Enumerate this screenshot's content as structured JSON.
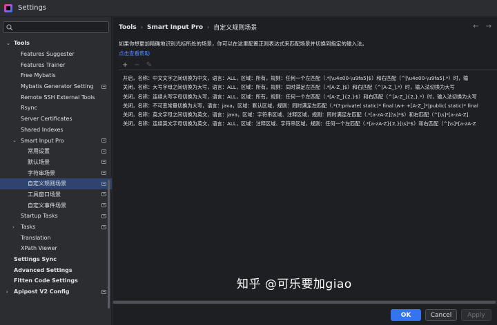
{
  "window": {
    "title": "Settings"
  },
  "search": {
    "value": ""
  },
  "sidebar": {
    "items": [
      {
        "label": "Tools",
        "bold": true,
        "indent": 0,
        "chevron": "down",
        "project": false
      },
      {
        "label": "Features Suggester",
        "indent": 1,
        "project": false
      },
      {
        "label": "Features Trainer",
        "indent": 1,
        "project": false
      },
      {
        "label": "Free Mybatis",
        "indent": 1,
        "project": false
      },
      {
        "label": "Mybatis Generator Setting",
        "indent": 1,
        "project": true
      },
      {
        "label": "Remote SSH External Tools",
        "indent": 1,
        "project": false
      },
      {
        "label": "Rsync",
        "indent": 1,
        "project": false
      },
      {
        "label": "Server Certificates",
        "indent": 1,
        "project": false
      },
      {
        "label": "Shared Indexes",
        "indent": 1,
        "project": false
      },
      {
        "label": "Smart Input Pro",
        "indent": 1,
        "chevron": "down",
        "project": true
      },
      {
        "label": "常用设置",
        "indent": 2,
        "project": true
      },
      {
        "label": "默认场景",
        "indent": 2,
        "project": true
      },
      {
        "label": "字符串场景",
        "indent": 2,
        "project": true
      },
      {
        "label": "自定义规则场景",
        "indent": 2,
        "project": true,
        "selected": true
      },
      {
        "label": "工具窗口场景",
        "indent": 2,
        "project": true
      },
      {
        "label": "自定义事件场景",
        "indent": 2,
        "project": true
      },
      {
        "label": "Startup Tasks",
        "indent": 1,
        "project": true
      },
      {
        "label": "Tasks",
        "indent": 1,
        "chevron": "right",
        "project": true
      },
      {
        "label": "Translation",
        "indent": 1,
        "project": false
      },
      {
        "label": "XPath Viewer",
        "indent": 1,
        "project": false
      },
      {
        "label": "Settings Sync",
        "bold": true,
        "indent": 0,
        "project": false
      },
      {
        "label": "Advanced Settings",
        "bold": true,
        "indent": 0,
        "project": false
      },
      {
        "label": "Fitten Code Settings",
        "bold": true,
        "indent": 0,
        "project": false
      },
      {
        "label": "Apipost V2 Config",
        "bold": true,
        "indent": 0,
        "chevron": "right",
        "project": true
      }
    ]
  },
  "breadcrumb": [
    "Tools",
    "Smart Input Pro",
    "自定义规则场景"
  ],
  "main": {
    "description": "如果你想更加精确地识别光标所处的场景，你可以在这里配置正则表达式来匹配场景并切换到指定的输入法。",
    "help_link": "点击查看帮助",
    "toolbar": {
      "add": "+",
      "remove": "−",
      "edit": "✎"
    },
    "rules": [
      "开启，名称：中文文字之间切换为中文，语言：ALL，区域：所有，规则：任何一个左匹配（.*[\\u4e00-\\u9fa5]$）和右匹配（^[\\u4e00-\\u9fa5].*）时，输",
      "关闭，名称：大写字母之间切换为大写，语言：ALL，区域：所有，规则：同时满足左匹配（.*[A-Z_]$）和右匹配（^[A-Z_].*）时，输入法切换为大写",
      "关闭，名称：连续大写字母切换为大写，语言：ALL，区域：所有，规则：任何一个左匹配（.*[A-Z_]{2,}$）和右匹配（^[A-Z_]{2,}.*）时，输入法切换为大写",
      "关闭，名称：不可变常量切换为大写，语言：java，区域：默认区域，规则：同时满足左匹配（.*(?:private( static)* final \\w+ +[A-Z_]*|public( static)* final",
      "关闭，名称：英文字母之间切换为英文，语言：java，区域：字符串区域、注释区域，规则：同时满足左匹配（.*[a-zA-Z][\\s]*$）和右匹配（^[\\s]*[a-zA-Z].",
      "关闭，名称：连续英文字母切换为英文，语言：ALL，区域：注释区域、字符串区域，规则：任何一个左匹配（.*[a-zA-Z]{2,}[\\s]*$）和右匹配（^[\\s]*[a-zA-Z"
    ]
  },
  "watermark": "知乎 @可乐要加giao",
  "buttons": {
    "ok": "OK",
    "cancel": "Cancel",
    "apply": "Apply"
  },
  "colors": {
    "accent": "#3574f0",
    "selection": "#2e436e",
    "link": "#548af7"
  }
}
